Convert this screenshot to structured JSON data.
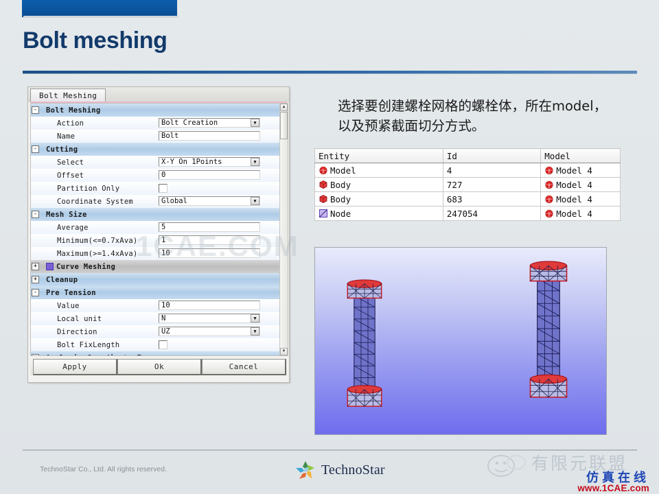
{
  "slide": {
    "title": "Bolt meshing",
    "accent_color": "#0d5daa",
    "title_color": "#123a6b"
  },
  "dialog": {
    "tab_label": "Bolt Meshing",
    "buttons": [
      {
        "name": "apply",
        "label": "Apply"
      },
      {
        "name": "ok",
        "label": "Ok"
      },
      {
        "name": "cancel",
        "label": "Cancel"
      }
    ],
    "rows": [
      {
        "kind": "group",
        "toggle": "-",
        "label": "Bolt Meshing"
      },
      {
        "kind": "combo",
        "label": "Action",
        "value": "Bolt Creation"
      },
      {
        "kind": "text",
        "label": "Name",
        "value": "Bolt"
      },
      {
        "kind": "group",
        "toggle": "-",
        "label": "Cutting"
      },
      {
        "kind": "combo",
        "label": "Select",
        "value": "X-Y On 1Points"
      },
      {
        "kind": "text",
        "label": "Offset",
        "value": "0"
      },
      {
        "kind": "check",
        "label": "Partition Only",
        "value": ""
      },
      {
        "kind": "combo",
        "label": "Coordinate System",
        "value": "Global"
      },
      {
        "kind": "group",
        "toggle": "-",
        "label": "Mesh Size"
      },
      {
        "kind": "text",
        "label": "Average",
        "value": "5"
      },
      {
        "kind": "text",
        "label": "Minimum(<=0.7xAva)",
        "value": "1"
      },
      {
        "kind": "text",
        "label": "Maximum(>=1.4xAva)",
        "value": "10"
      },
      {
        "kind": "group-swatch",
        "toggle": "+",
        "label": "Curve Meshing",
        "swatch": "#7b5fd6"
      },
      {
        "kind": "group",
        "toggle": "+",
        "label": "Cleanup"
      },
      {
        "kind": "group",
        "toggle": "-",
        "label": "Pre Tension"
      },
      {
        "kind": "text",
        "label": "Value",
        "value": "10"
      },
      {
        "kind": "combo",
        "label": "Local unit",
        "value": "N"
      },
      {
        "kind": "combo",
        "label": "Direction",
        "value": "UZ"
      },
      {
        "kind": "check",
        "label": "Bolt FixLength",
        "value": ""
      },
      {
        "kind": "group",
        "toggle": "-",
        "label": "Analysis Coordinate Frame"
      }
    ]
  },
  "annotation": {
    "line1": "选择要创建螺栓网格的螺栓体，所在model，",
    "line2": "以及预紧截面切分方式。"
  },
  "entity_table": {
    "headers": [
      "Entity",
      "Id",
      "Model"
    ],
    "rows": [
      {
        "icon": "model-icon",
        "entity": "Model",
        "id": "4",
        "model_icon": "model-icon",
        "model": "Model 4"
      },
      {
        "icon": "body-icon",
        "entity": "Body",
        "id": "727",
        "model_icon": "model-icon",
        "model": "Model 4"
      },
      {
        "icon": "body-icon",
        "entity": "Body",
        "id": "683",
        "model_icon": "model-icon",
        "model": "Model 4"
      },
      {
        "icon": "node-icon",
        "entity": "Node",
        "id": "247054",
        "model_icon": "model-icon",
        "model": "Model 4"
      }
    ]
  },
  "viewport": {
    "description": "3D meshed bolt models on blue gradient background",
    "bolt_count": 2
  },
  "watermarks": {
    "center": "1CAE.COM",
    "cn_brand": "有限元联盟",
    "cn_sub": "仿真在线",
    "url": "www.1CAE.com"
  },
  "footer": {
    "copyright": "TechnoStar Co., Ltd. All rights reserved.",
    "logo_text": "TechnoStar"
  }
}
